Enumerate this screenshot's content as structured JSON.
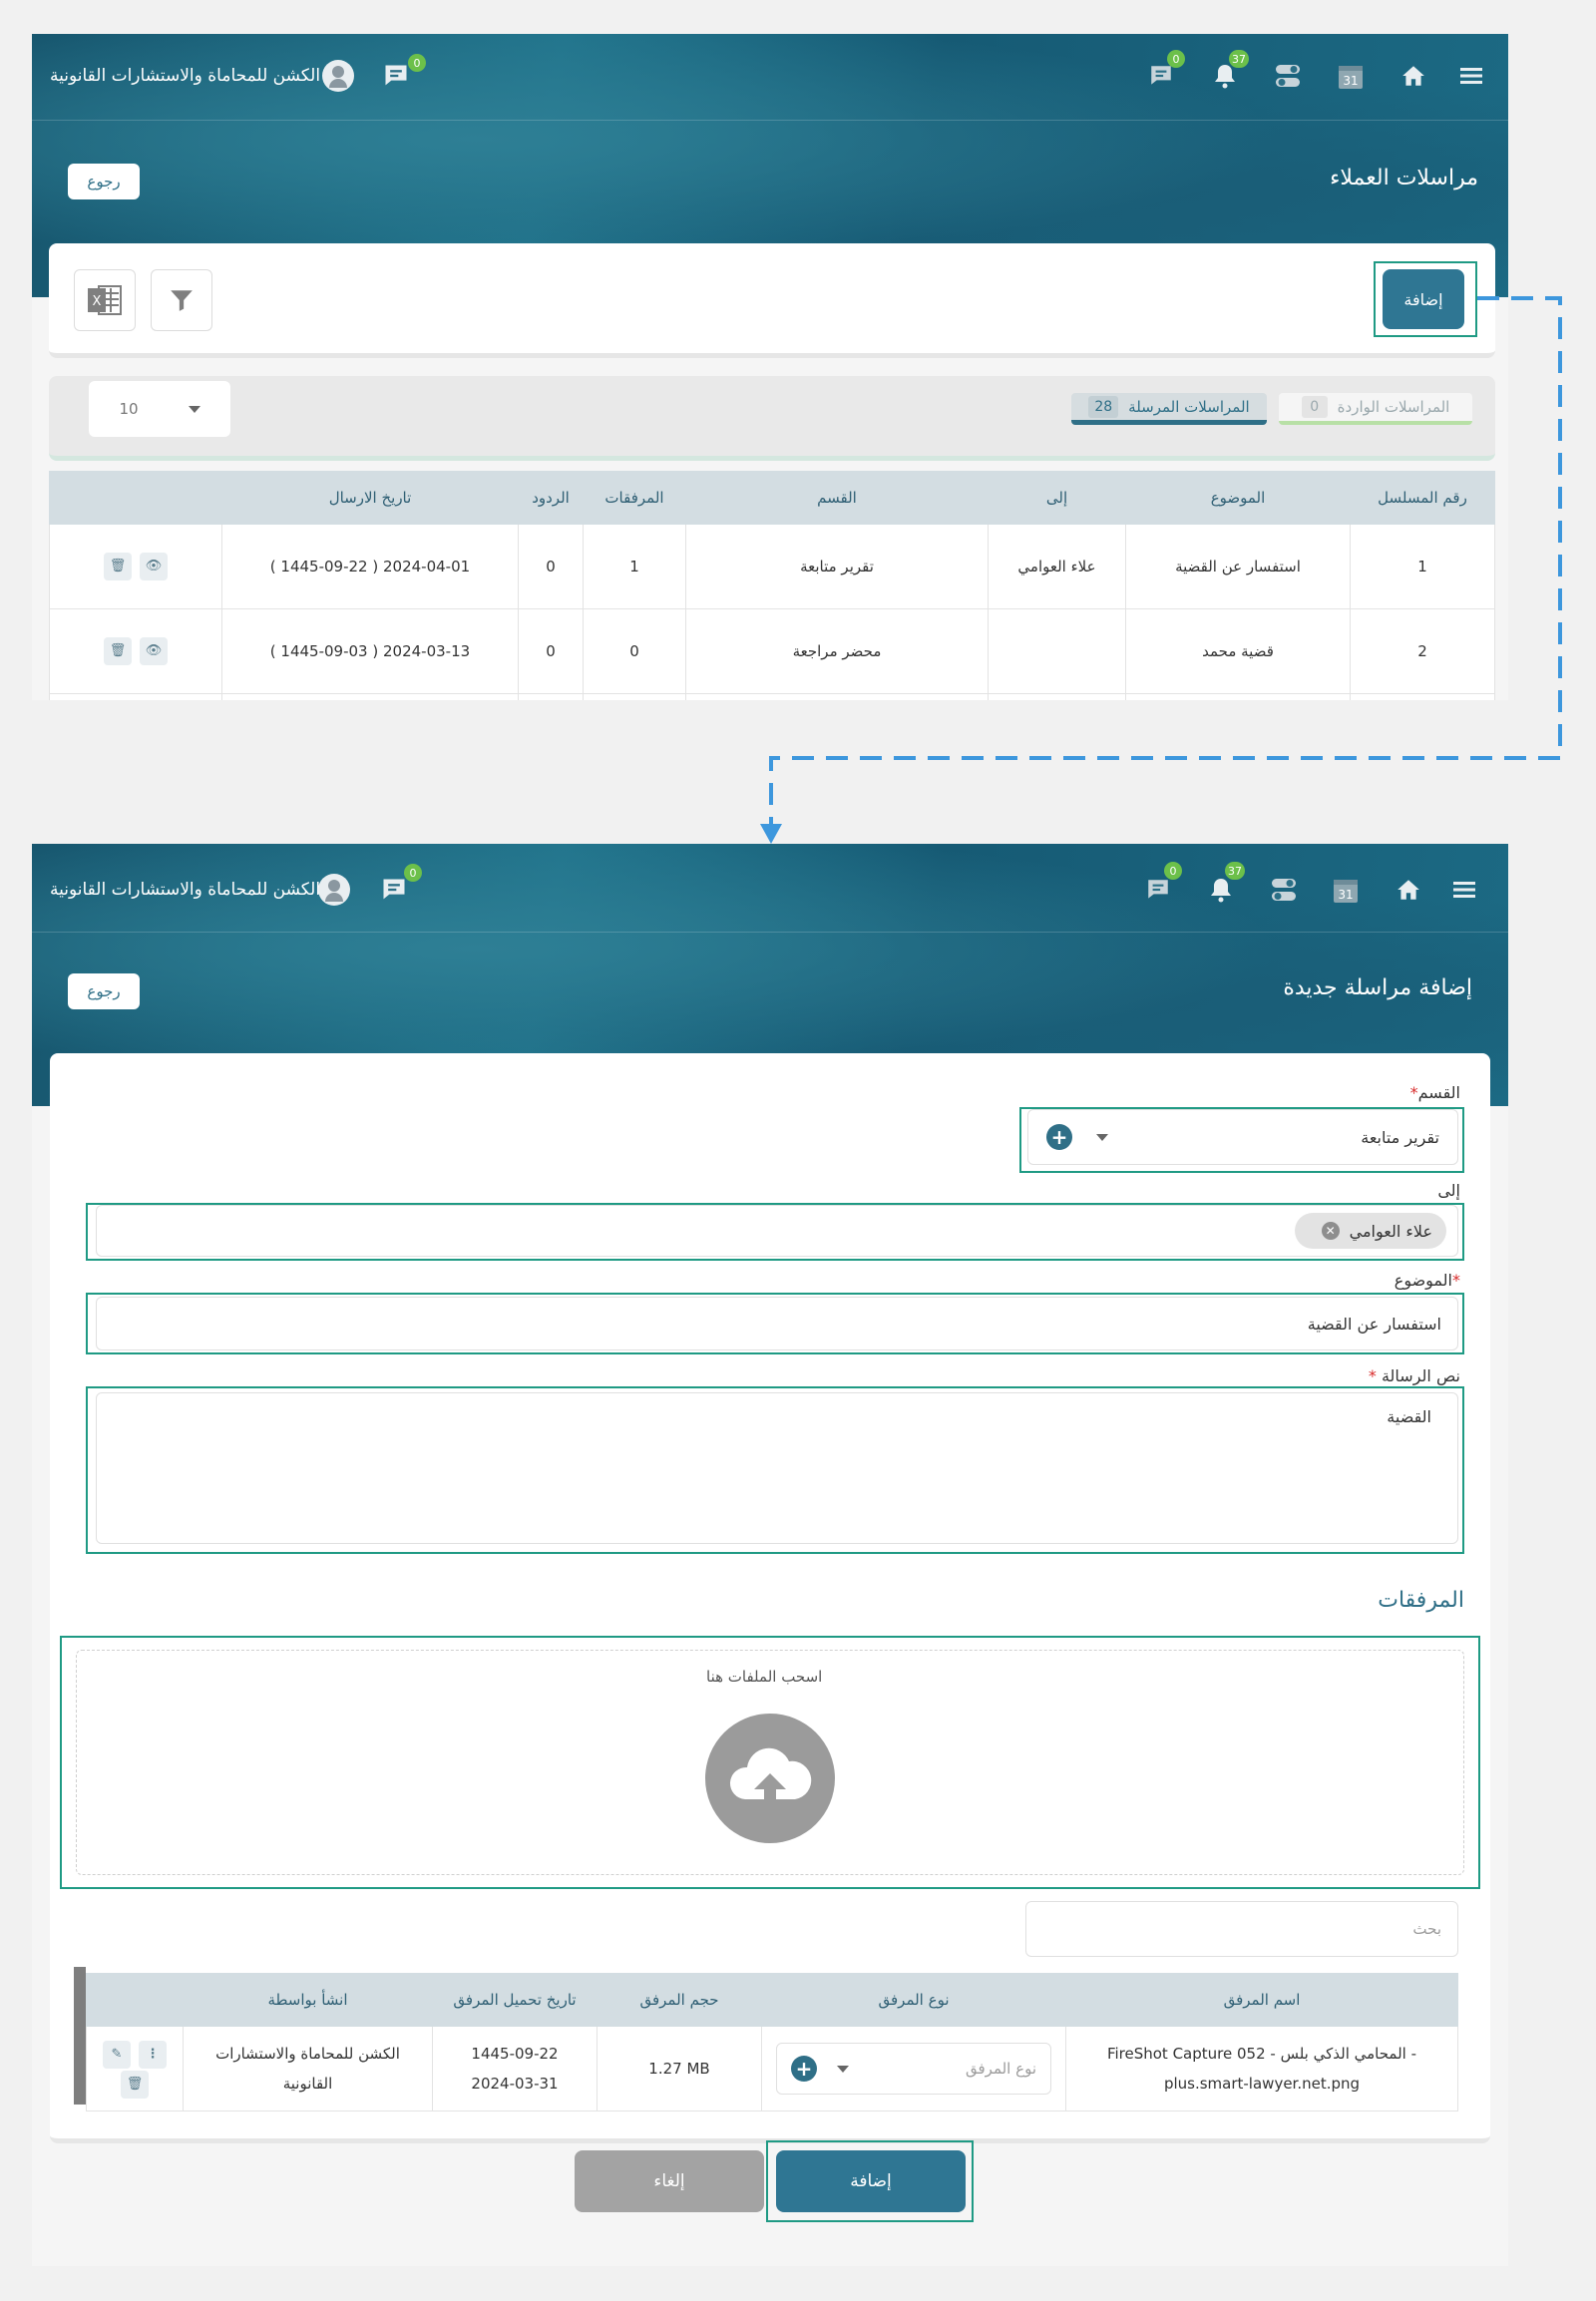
{
  "header": {
    "brand": "الكشن للمحاماة والاستشارات القانونية",
    "chat_badge": "0",
    "messages_badge": "0",
    "notifications_badge": "37",
    "calendar_day": "31"
  },
  "list_page": {
    "title": "مراسلات العملاء",
    "back_label": "رجوع",
    "add_label": "إضافة",
    "tabs": {
      "incoming_label": "المراسلات الواردة",
      "incoming_count": "0",
      "sent_label": "المراسلات المرسلة",
      "sent_count": "28"
    },
    "page_size": "10",
    "columns": [
      "رقم المسلسل",
      "الموضوع",
      "إلى",
      "القسم",
      "المرفقات",
      "الردود",
      "تاريخ الارسال",
      ""
    ],
    "rows": [
      {
        "serial": "1",
        "subject": "استفسار عن القضية",
        "to": "علاء العوامي",
        "section": "تقرير متابعة",
        "attachments": "1",
        "replies": "0",
        "date": "2024-04-01 ( 1445-09-22 )"
      },
      {
        "serial": "2",
        "subject": "قضية محمد",
        "to": "",
        "section": "محضر مراجعة",
        "attachments": "0",
        "replies": "0",
        "date": "2024-03-13 ( 1445-09-03 )"
      }
    ]
  },
  "form_page": {
    "title": "إضافة مراسلة جديدة",
    "back_label": "رجوع",
    "section_label": "القسم",
    "section_value": "تقرير متابعة",
    "to_label": "إلى",
    "to_chip": "علاء العوامي",
    "subject_label": "الموضوع",
    "subject_value": "استفسار عن القضية",
    "body_label": "نص الرسالة",
    "body_value": "القضية",
    "attachments_title": "المرفقات",
    "dropzone_text": "اسحب الملفات هنا",
    "search_placeholder": "بحث",
    "att_columns": [
      "اسم المرفق",
      "نوع المرفق",
      "حجم المرفق",
      "تاريخ تحميل المرفق",
      "انشأ بواسطة",
      ""
    ],
    "att_rows": [
      {
        "name_line1": "FireShot Capture 052 - المحامي الذكي بلس -",
        "name_line2": "plus.smart-lawyer.net.png",
        "type_placeholder": "نوع المرفق",
        "size": "1.27 MB",
        "date_hijri": "1445-09-22",
        "date_greg": "2024-03-31",
        "created_by_line1": "الكشن للمحاماة والاستشارات",
        "created_by_line2": "القانونية"
      }
    ],
    "submit_label": "إضافة",
    "cancel_label": "إلغاء"
  },
  "colors": {
    "accent": "#2f7693",
    "highlight": "#1f9a84",
    "arrow": "#3d97dd",
    "badge": "#6cc04a"
  }
}
